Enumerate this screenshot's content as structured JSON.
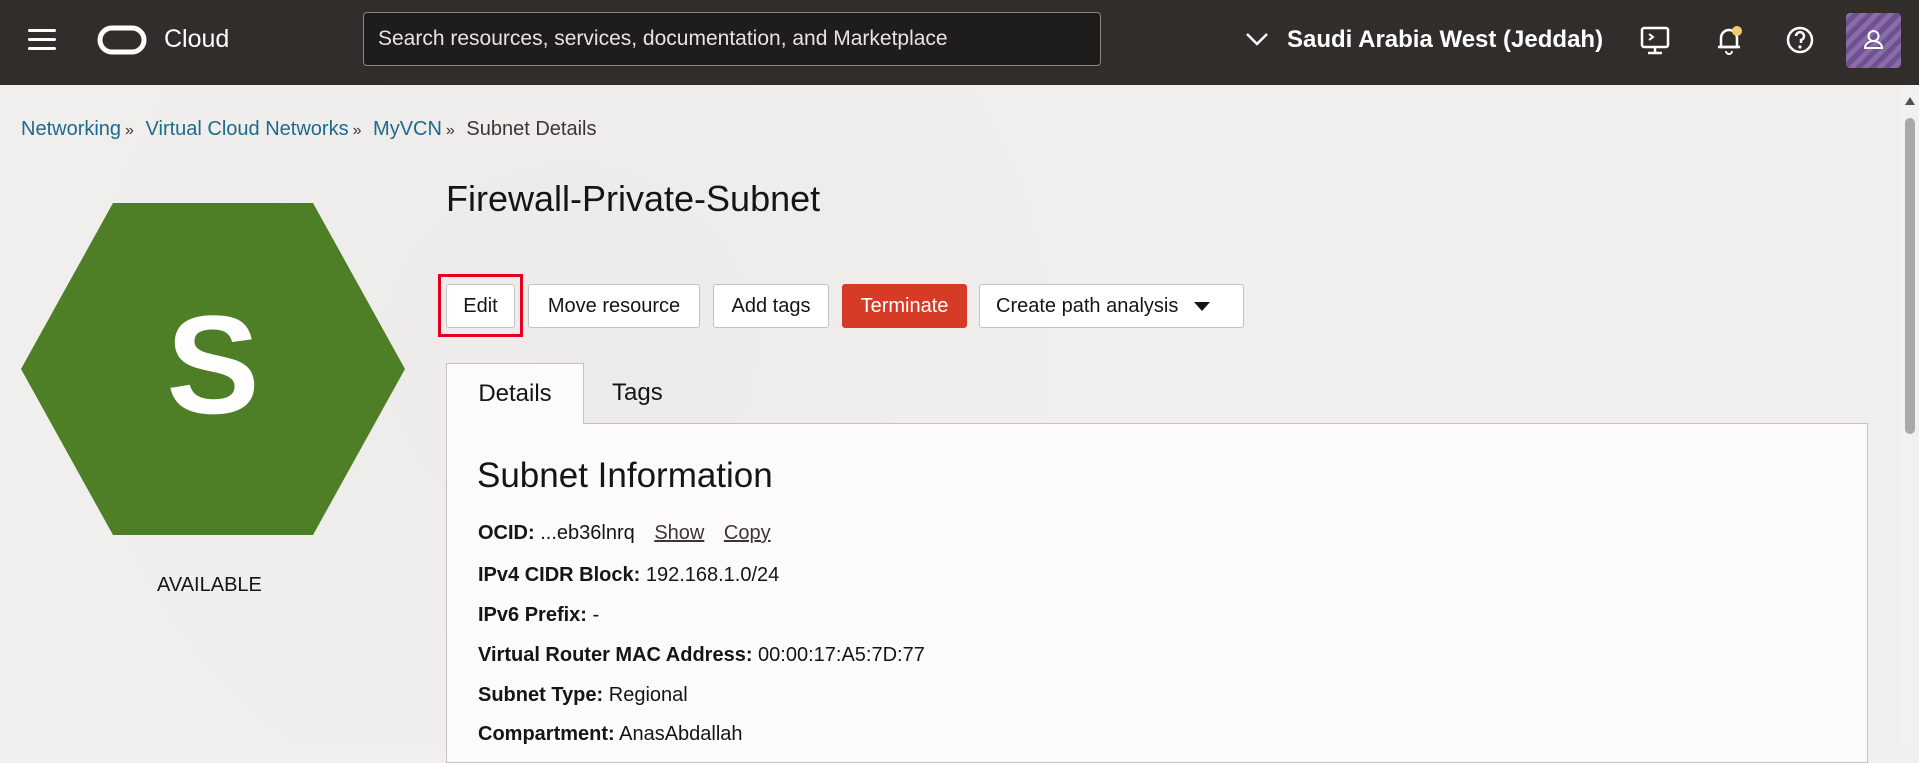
{
  "header": {
    "brand": "Cloud",
    "search_placeholder": "Search resources, services, documentation, and Marketplace",
    "region": "Saudi Arabia West (Jeddah)"
  },
  "breadcrumb": {
    "items": [
      "Networking",
      "Virtual Cloud Networks",
      "MyVCN"
    ],
    "current": "Subnet Details"
  },
  "resource": {
    "icon_letter": "S",
    "icon_color": "#4e7e25",
    "status": "AVAILABLE",
    "title": "Firewall-Private-Subnet"
  },
  "actions": {
    "edit": "Edit",
    "move": "Move resource",
    "add_tags": "Add tags",
    "terminate": "Terminate",
    "path_analysis": "Create path analysis"
  },
  "tabs": {
    "details": "Details",
    "tags": "Tags"
  },
  "info": {
    "title": "Subnet Information",
    "ocid_label": "OCID:",
    "ocid_value": "...eb36lnrq",
    "show": "Show",
    "copy": "Copy",
    "ipv4_label": "IPv4 CIDR Block:",
    "ipv4_value": "192.168.1.0/24",
    "ipv6_label": "IPv6 Prefix:",
    "ipv6_value": "-",
    "mac_label": "Virtual Router MAC Address:",
    "mac_value": "00:00:17:A5:7D:77",
    "type_label": "Subnet Type:",
    "type_value": "Regional",
    "compartment_label": "Compartment:",
    "compartment_value": "AnasAbdallah"
  }
}
